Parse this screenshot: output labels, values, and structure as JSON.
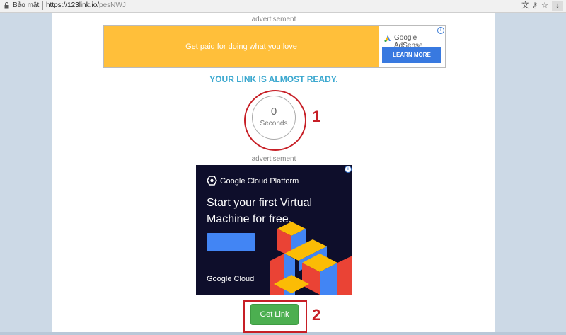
{
  "browser": {
    "secure_label": "Bảo mật",
    "url_host": "https://123link.io/",
    "url_path": "pesNWJ",
    "translate_icon": "translate-icon",
    "key_icon": "key-icon",
    "star_icon": "star-icon",
    "download_icon": "download-icon"
  },
  "page": {
    "ad_label_top": "advertisement",
    "banner": {
      "text": "Get paid for doing what you love",
      "brand": "Google AdSense",
      "cta": "LEARN MORE",
      "info": "i"
    },
    "ready_text": "YOUR LINK IS ALMOST READY.",
    "countdown": {
      "value": "0",
      "unit": "Seconds"
    },
    "ad_label_middle": "advertisement",
    "gcp_ad": {
      "brand": "Google Cloud Platform",
      "headline": "Start your first Virtual Machine for free.",
      "footer": "Google Cloud",
      "info": "i"
    },
    "get_link_label": "Get Link"
  },
  "annotations": {
    "step1": "1",
    "step2": "2",
    "color": "#c71f26"
  },
  "colors": {
    "banner_bg": "#ffbf3a",
    "ready_text": "#3ba8cf",
    "button_green": "#4caf50",
    "gcp_bg": "#0e0e2b"
  }
}
